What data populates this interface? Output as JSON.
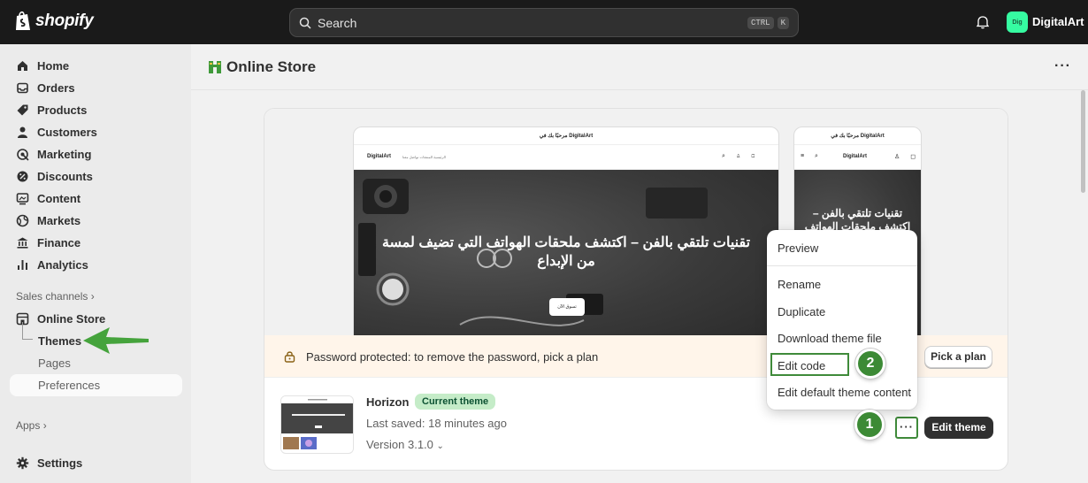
{
  "topbar": {
    "brand": "shopify",
    "search_placeholder": "Search",
    "shortcut_keys": [
      "CTRL",
      "K"
    ],
    "avatar_initials": "Dig",
    "store_name": "DigitalArt"
  },
  "sidebar": {
    "items": [
      {
        "label": "Home",
        "icon": "home-icon"
      },
      {
        "label": "Orders",
        "icon": "inbox-icon"
      },
      {
        "label": "Products",
        "icon": "tag-icon"
      },
      {
        "label": "Customers",
        "icon": "person-icon"
      },
      {
        "label": "Marketing",
        "icon": "target-icon"
      },
      {
        "label": "Discounts",
        "icon": "discount-icon"
      },
      {
        "label": "Content",
        "icon": "content-icon"
      },
      {
        "label": "Markets",
        "icon": "globe-icon"
      },
      {
        "label": "Finance",
        "icon": "bank-icon"
      },
      {
        "label": "Analytics",
        "icon": "chart-icon"
      }
    ],
    "sales_channels_label": "Sales channels",
    "online_store_label": "Online Store",
    "sub_items": [
      "Themes",
      "Pages",
      "Preferences"
    ],
    "apps_label": "Apps",
    "settings_label": "Settings"
  },
  "page": {
    "title": "Online Store",
    "more": "···"
  },
  "preview": {
    "announcement": "مرحبًا بك في DigitalArt",
    "brand": "DigitalArt",
    "nav_links": "الرئيسية   المنتجات   تواصل معنا",
    "hero_heading": "تقنيات تلتقي بالفن – اكتشف ملحقات الهواتف التي تضيف لمسة من الإبداع",
    "hero_button": "تسوق الآن",
    "mobile_hero_heading": "تقنيات تلتقي بالفن – اكتشف ملحقات الهواتف التي"
  },
  "password_bar": {
    "text": "Password protected: to remove the password, pick a plan",
    "button": "Pick a plan"
  },
  "theme": {
    "name": "Horizon",
    "badge": "Current theme",
    "saved": "Last saved: 18 minutes ago",
    "version": "Version 3.1.0",
    "more_button": "···",
    "edit_button": "Edit theme"
  },
  "menu": {
    "items": [
      "Preview",
      "Rename",
      "Duplicate",
      "Download theme file",
      "Edit code",
      "Edit default theme content"
    ]
  },
  "annotations": {
    "step1": "1",
    "step2": "2"
  },
  "colors": {
    "topbar": "#1a1a1a",
    "annotation_green": "#3c8a35",
    "badge_bg": "#c5ecc8",
    "password_bg": "#fff5ea"
  }
}
